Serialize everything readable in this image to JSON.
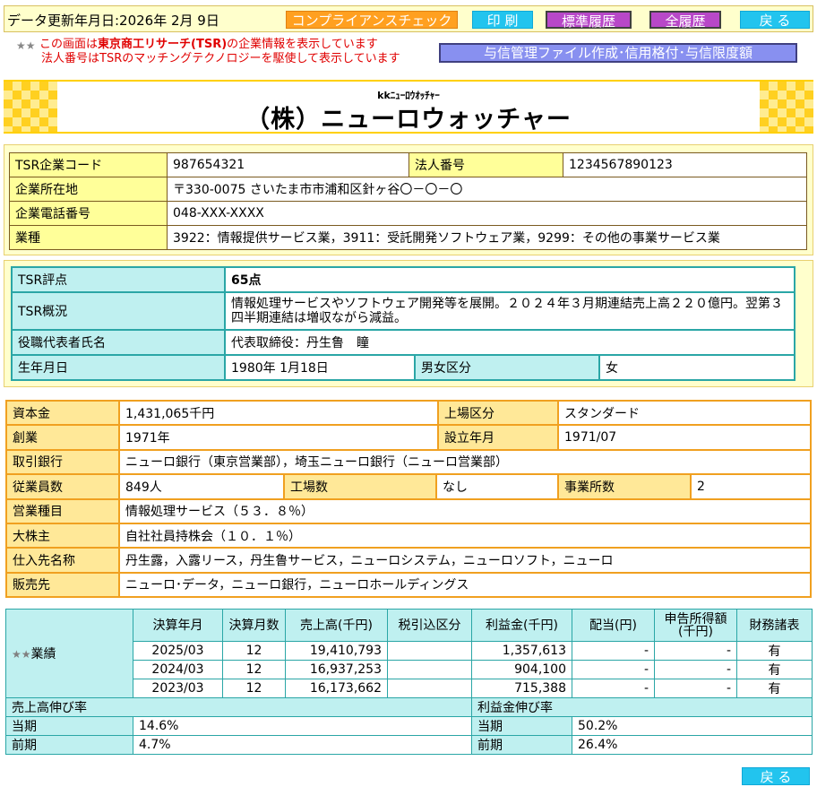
{
  "topbar": {
    "update_label": "データ更新年月日:2026年 2月 9日",
    "buttons": {
      "compliance": "コンプライアンスチェック",
      "print": "印 刷",
      "std_history": "標準履歴",
      "all_history": "全履歴",
      "back": "戻 る"
    }
  },
  "notice": {
    "line1_prefix": "この画面は",
    "line1_bold": "東京商工リサーチ(TSR)",
    "line1_suffix": "の企業情報を表示しています",
    "line2": "法人番号はTSRのマッチングテクノロジーを駆使して表示しています"
  },
  "credit_button": "与信管理ファイル作成･信用格付･与信限度額",
  "company": {
    "kana": "kkﾆｭｰﾛｳｵｯﾁｬｰ",
    "name": "（株）ニューロウォッチャー"
  },
  "basic": {
    "tsr_code_label": "TSR企業コード",
    "tsr_code": "987654321",
    "corp_no_label": "法人番号",
    "corp_no": "1234567890123",
    "address_label": "企業所在地",
    "address": "〒330-0075 さいたま市市浦和区針ヶ谷〇－〇－〇",
    "phone_label": "企業電話番号",
    "phone": "048-XXX-XXXX",
    "industry_label": "業種",
    "industry": "3922：情報提供サービス業，3911：受託開発ソフトウェア業，9299：その他の事業サービス業"
  },
  "tsr": {
    "score_label": "TSR評点",
    "score": "65点",
    "overview_label": "TSR概況",
    "overview": "情報処理サービスやソフトウェア開発等を展開。２０２４年３月期連結売上高２２０億円。翌第３四半期連結は増収ながら減益。",
    "rep_label": "役職代表者氏名",
    "rep": "代表取締役：丹生鲁　瞳",
    "birth_label": "生年月日",
    "birth": "1980年 1月18日",
    "gender_label": "男女区分",
    "gender": "女"
  },
  "profile": {
    "capital_label": "資本金",
    "capital": "1,431,065千円",
    "listing_label": "上場区分",
    "listing": "スタンダード",
    "founded_label": "創業",
    "founded": "1971年",
    "established_label": "設立年月",
    "established": "1971/07",
    "bank_label": "取引銀行",
    "bank": "ニューロ銀行（東京営業部），埼玉ニューロ銀行（ニューロ営業部）",
    "employees_label": "従業員数",
    "employees": "849人",
    "factories_label": "工場数",
    "factories": "なし",
    "offices_label": "事業所数",
    "offices": "2",
    "business_label": "営業種目",
    "business": "情報処理サービス（５３．８％）",
    "shareholder_label": "大株主",
    "shareholder": "自社社員持株会（１０．１％）",
    "suppliers_label": "仕入先名称",
    "suppliers": "丹生露，入露リース，丹生鲁サービス，ニューロシステム，ニューロソフト，ニューロ",
    "customers_label": "販売先",
    "customers": "ニューロ･データ，ニューロ銀行，ニューロホールディングス"
  },
  "results": {
    "section_label": "業績",
    "headers": {
      "period": "決算年月",
      "months": "決算月数",
      "sales": "売上高(千円)",
      "tax": "税引込区分",
      "profit": "利益金(千円)",
      "dividend": "配当(円)",
      "declared": "申告所得額(千円)",
      "fin": "財務諸表"
    },
    "rows": [
      {
        "period": "2025/03",
        "months": "12",
        "sales": "19,410,793",
        "tax": "",
        "profit": "1,357,613",
        "dividend": "-",
        "declared": "-",
        "fin": "有"
      },
      {
        "period": "2024/03",
        "months": "12",
        "sales": "16,937,253",
        "tax": "",
        "profit": "904,100",
        "dividend": "-",
        "declared": "-",
        "fin": "有"
      },
      {
        "period": "2023/03",
        "months": "12",
        "sales": "16,173,662",
        "tax": "",
        "profit": "715,388",
        "dividend": "-",
        "declared": "-",
        "fin": "有"
      }
    ],
    "sales_growth_label": "売上高伸び率",
    "profit_growth_label": "利益金伸び率",
    "current_label": "当期",
    "previous_label": "前期",
    "sales_growth_current": "14.6%",
    "sales_growth_previous": "4.7%",
    "profit_growth_current": "50.2%",
    "profit_growth_previous": "26.4%"
  },
  "bottom_back": "戻 る",
  "colors": {
    "accent_orange": "#ffa020",
    "accent_cyan": "#22c4ee",
    "accent_purple": "#b848c8",
    "notice_red": "#e00000"
  }
}
